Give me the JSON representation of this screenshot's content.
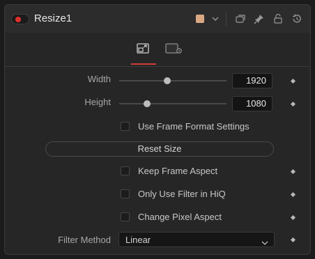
{
  "header": {
    "title": "Resize1",
    "enabled": true,
    "color_swatch": "#d9a882",
    "icons": [
      "dropdown-chevron-icon",
      "copy-icon",
      "pin-icon",
      "lock-icon",
      "reset-icon"
    ]
  },
  "tabs": [
    {
      "name": "controls-tab",
      "icon": "resize-icon",
      "active": true
    },
    {
      "name": "settings-tab",
      "icon": "settings-icon",
      "active": false
    }
  ],
  "controls": {
    "width": {
      "label": "Width",
      "value": "1920",
      "slider_fraction": 0.45
    },
    "height": {
      "label": "Height",
      "value": "1080",
      "slider_fraction": 0.26
    },
    "use_frame_format": {
      "label": "Use Frame Format Settings",
      "checked": false
    },
    "reset_size": {
      "label": "Reset Size"
    },
    "keep_frame_aspect": {
      "label": "Keep Frame Aspect",
      "checked": false
    },
    "only_use_filter_hiq": {
      "label": "Only Use Filter in HiQ",
      "checked": false
    },
    "change_pixel_aspect": {
      "label": "Change Pixel Aspect",
      "checked": false
    },
    "filter_method": {
      "label": "Filter Method",
      "value": "Linear"
    }
  },
  "colors": {
    "accent_red": "#d23b38",
    "panel_bg": "#262626",
    "field_bg": "#141414"
  }
}
